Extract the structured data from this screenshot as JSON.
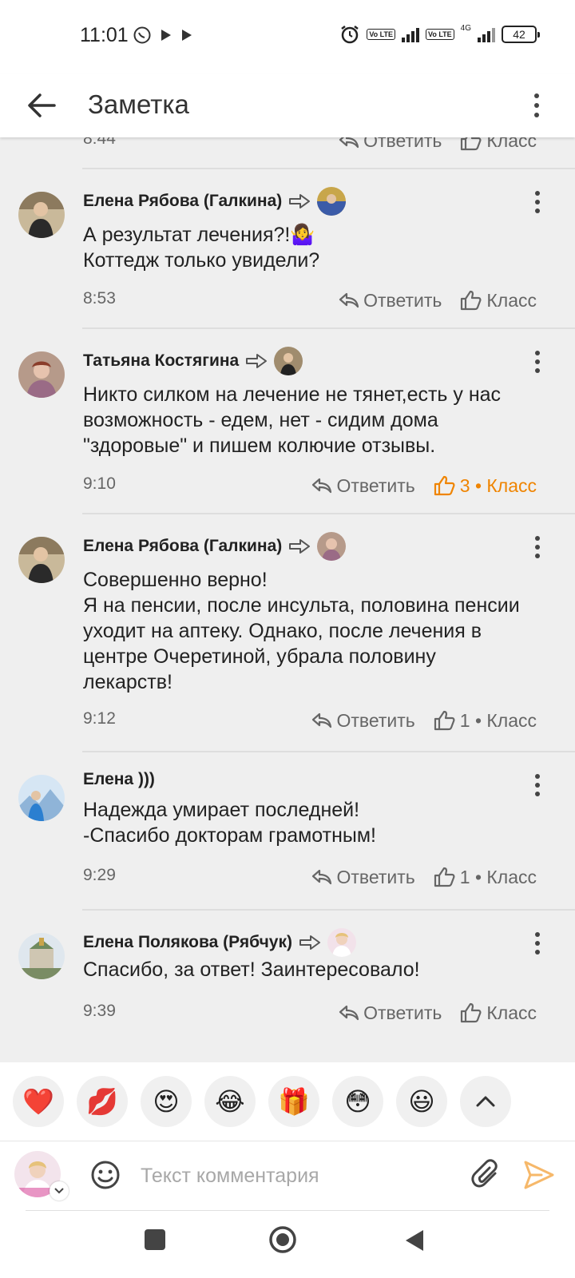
{
  "status_bar": {
    "time": "11:01",
    "battery": "42",
    "network": "4G",
    "volte": "Vo LTE"
  },
  "app_bar": {
    "title": "Заметка"
  },
  "top_partial": {
    "time": "8:44",
    "reply": "Ответить",
    "like": "Класс"
  },
  "comments": [
    {
      "author": "Елена Рябова (Галкина)",
      "text": "А результат лечения?!🤷‍♀️\nКоттедж только увидели?",
      "time": "8:53",
      "reply": "Ответить",
      "like": "Класс",
      "avatar_color": "#6b5a47",
      "reply_avatar_color": "#3b5ba8"
    },
    {
      "author": "Татьяна Костягина",
      "text": "Никто силком на лечение не тянет,есть у нас возможность - едем, нет - сидим дома \"здоровые\" и пишем колючие отзывы.",
      "time": "9:10",
      "reply": "Ответить",
      "like": "3 • Класс",
      "liked": true,
      "avatar_color": "#9a6b86",
      "reply_avatar_color": "#5b4a3a"
    },
    {
      "author": "Елена Рябова (Галкина)",
      "text": "Совершенно верно!\nЯ на пенсии, после инсульта, половина пенсии уходит на аптеку. Однако, после лечения в центре Очеретиной, убрала половину лекарств!",
      "time": "9:12",
      "reply": "Ответить",
      "like": "1 • Класс",
      "avatar_color": "#6b5a47",
      "reply_avatar_color": "#9a6b86"
    },
    {
      "author": "Елена )))",
      "text": "Надежда умирает последней!\n-Спасибо докторам грамотным!",
      "time": "9:29",
      "reply": "Ответить",
      "like": "1 • Класс",
      "avatar_color": "#4b8fd0",
      "reply_avatar_color": ""
    },
    {
      "author": "Елена Полякова (Рябчук)",
      "text": "Спасибо, за ответ! Заинтересовало!",
      "time": "9:39",
      "reply": "Ответить",
      "like": "Класс",
      "avatar_color": "#8a9a7a",
      "reply_avatar_color": "#e8b5c8"
    }
  ],
  "reactions": [
    "❤️",
    "💋",
    "😍",
    "😂",
    "🎁",
    "😳",
    "😃"
  ],
  "compose": {
    "placeholder": "Текст комментария"
  },
  "colors": {
    "accent": "#ef8400",
    "background": "#efefef",
    "send": "#f6b86a"
  }
}
